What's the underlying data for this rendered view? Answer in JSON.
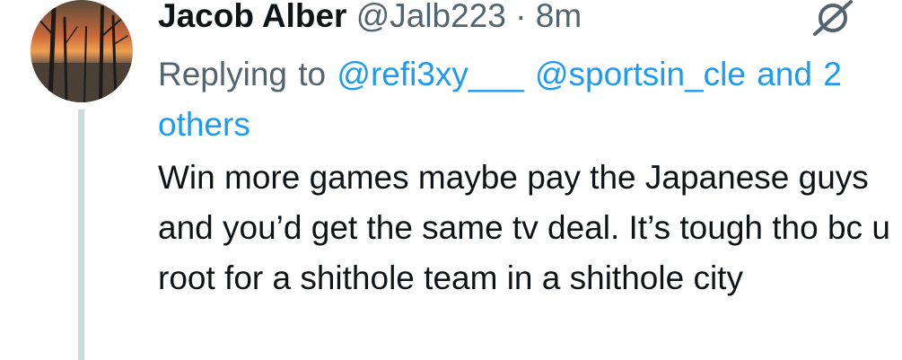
{
  "tweet": {
    "author_name": "Jacob Alber",
    "author_handle": "@Jalb223",
    "separator": "·",
    "time": "8m",
    "replying_prefix": "Replying to",
    "mentions": [
      "@refi3xy___",
      "@sportsin_cle"
    ],
    "mention_more": "and 2 others",
    "text": "Win more games maybe pay the Japanese guys and you’d get the same tv deal. It’s tough tho bc u root for a shithole team in a shithole city"
  },
  "icons": {
    "avatar": "avatar-sunset-trees",
    "grok": "grok-icon"
  },
  "colors": {
    "name": "#0f1419",
    "secondary": "#536471",
    "link": "#1d9bf0",
    "thread_line": "#cfd9de"
  }
}
